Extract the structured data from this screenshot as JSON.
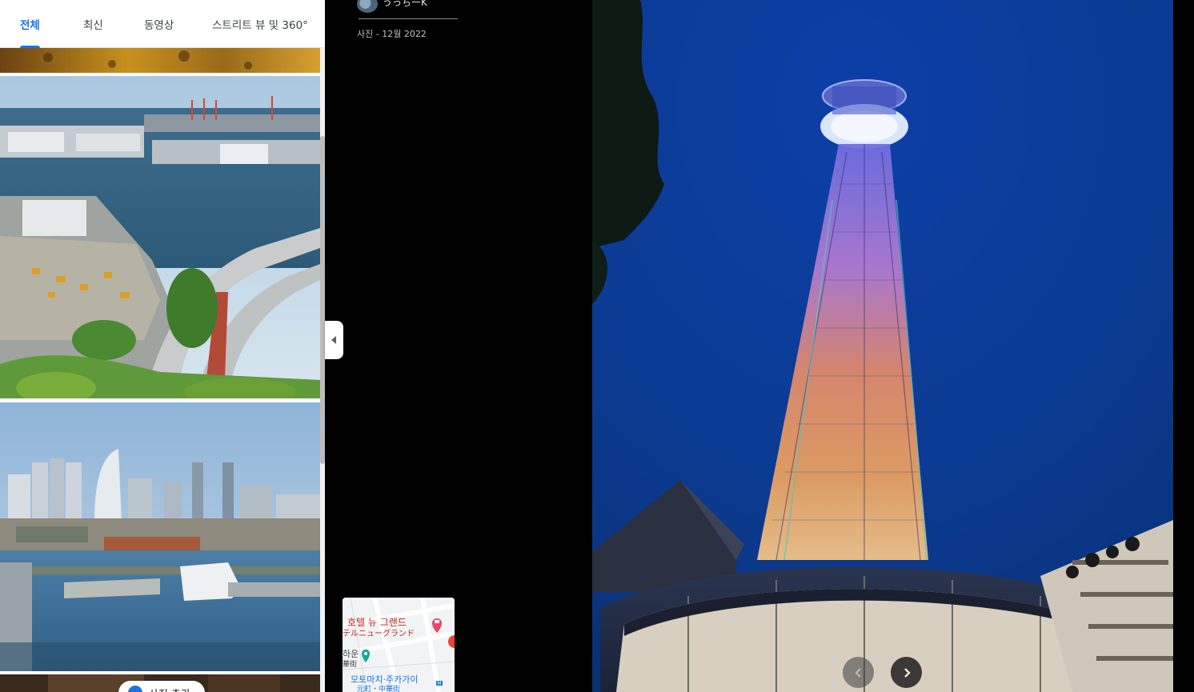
{
  "tabs": [
    {
      "label": "전체",
      "active": true
    },
    {
      "label": "최신",
      "active": false
    },
    {
      "label": "동영상",
      "active": false
    },
    {
      "label": "스트리트 뷰 및 360°",
      "active": false
    }
  ],
  "contributor": {
    "name": "うっちーK",
    "date_label": "사진 - 12월 2022"
  },
  "map": {
    "hotel_label": "호텔 뉴 그랜드",
    "hotel_label_jp": "テルニューグランド",
    "station_label": "모토마치·주카가이",
    "area_label": "元町・中華街",
    "partial_left_label": "하운",
    "partial_left_label2": "華街"
  },
  "photo_chip": {
    "label": "사진 추가"
  },
  "nav": {
    "prev_icon": "chevron-left-icon",
    "next_icon": "chevron-right-icon"
  },
  "colors": {
    "accent": "#1a73e8",
    "sky": "#0a3f94",
    "background": "#000000"
  }
}
